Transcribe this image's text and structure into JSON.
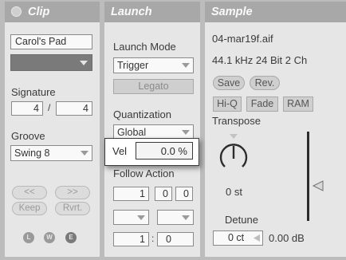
{
  "clip": {
    "title": "Clip",
    "name": "Carol's Pad",
    "signature_label": "Signature",
    "signature_num": "4",
    "signature_sep": "/",
    "signature_den": "4",
    "groove_label": "Groove",
    "groove_value": "Swing 8",
    "nudge_back": "<<",
    "nudge_forward": ">>",
    "keep": "Keep",
    "revert": "Rvrt.",
    "icons": [
      "L",
      "W",
      "E"
    ],
    "color": "#7a7a7a"
  },
  "launch": {
    "title": "Launch",
    "launch_mode_label": "Launch Mode",
    "launch_mode_value": "Trigger",
    "legato": "Legato",
    "quantization_label": "Quantization",
    "quantization_value": "Global",
    "vel_label": "Vel",
    "vel_value": "0.0 %",
    "follow_action_label": "Follow Action",
    "follow_time": [
      "1",
      "0",
      "0"
    ],
    "chance_a": "1",
    "chance_sep": ":",
    "chance_b": "0"
  },
  "sample": {
    "title": "Sample",
    "file_name": "04-mar19f.aif",
    "file_info": "44.1 kHz 24 Bit 2 Ch",
    "save": "Save",
    "rev": "Rev.",
    "hiq": "Hi-Q",
    "fade": "Fade",
    "ram": "RAM",
    "transpose_label": "Transpose",
    "transpose_value": "0 st",
    "detune_label": "Detune",
    "detune_value": "0 ct",
    "gain_value": "0.00 dB"
  }
}
